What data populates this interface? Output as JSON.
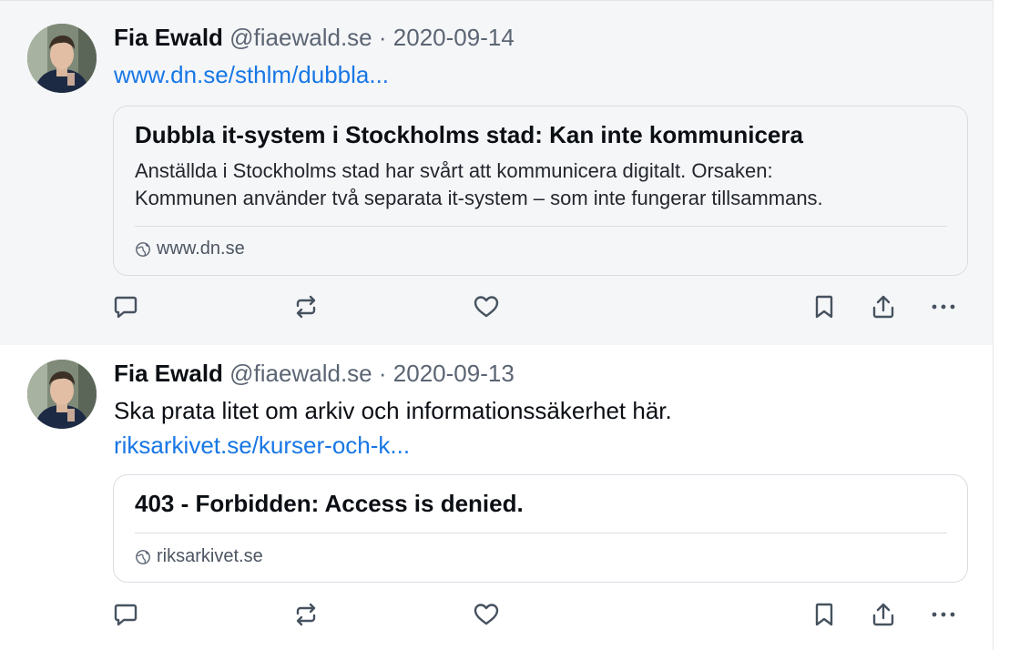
{
  "posts": [
    {
      "author": "Fia Ewald",
      "handle": "@fiaewald.se",
      "separator": "·",
      "date": "2020-09-14",
      "text": "",
      "link": "www.dn.se/sthlm/dubbla...",
      "card": {
        "title": "Dubbla it-system i Stockholms stad: Kan inte kommunicera",
        "description_lines": [
          "Anställda i Stockholms stad har svårt att kommunicera digitalt. Orsaken:",
          "Kommunen använder två separata it-system – som inte fungerar tillsammans."
        ],
        "domain": "www.dn.se",
        "domain_icon": "globe-icon"
      }
    },
    {
      "author": "Fia Ewald",
      "handle": "@fiaewald.se",
      "separator": "·",
      "date": "2020-09-13",
      "text": "Ska prata litet om arkiv och informationssäkerhet här.",
      "link": "riksarkivet.se/kurser-och-k...",
      "card": {
        "title": "403 - Forbidden: Access is denied.",
        "description_lines": [],
        "domain": "riksarkivet.se",
        "domain_icon": "globe-icon"
      }
    }
  ],
  "actions": [
    "reply-icon",
    "repost-icon",
    "like-icon",
    "bookmark-icon",
    "share-icon",
    "more-icon"
  ],
  "colors": {
    "link": "#1877e5",
    "text": "#0b0f14",
    "muted": "#5b6573",
    "icon": "#46525f",
    "selected_bg": "#f5f6f8"
  }
}
